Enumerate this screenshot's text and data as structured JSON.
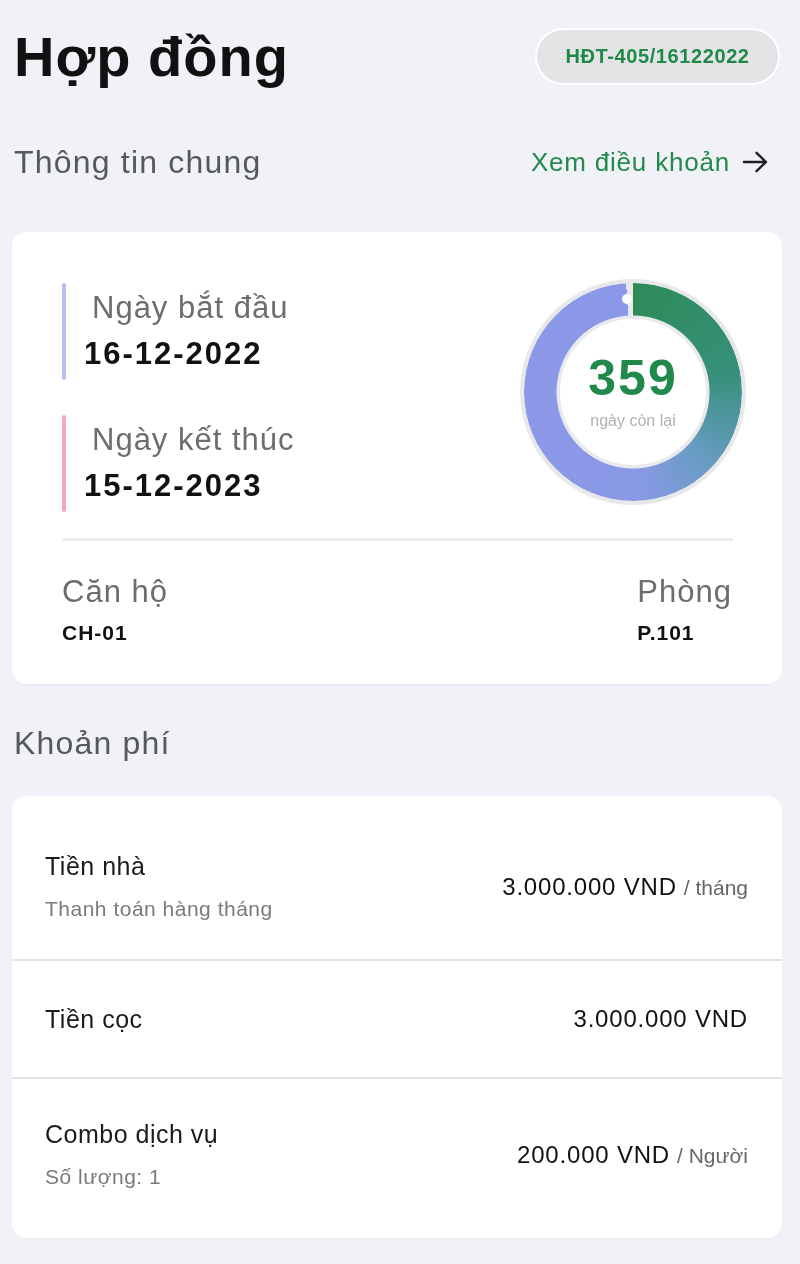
{
  "header": {
    "title": "Hợp đồng",
    "contract_code": "HĐT-405/16122022"
  },
  "general_info": {
    "heading": "Thông tin chung",
    "link": "Xem điều khoản",
    "dates": [
      {
        "label": "Ngày bắt đầu",
        "value": "16-12-2022",
        "color": "#b8c2ef"
      },
      {
        "label": "Ngày kết thúc",
        "value": "15-12-2023",
        "color": "#f2a8c1"
      }
    ],
    "remaining": {
      "value": "359",
      "caption": "ngày còn lại",
      "level": 0.99
    },
    "details": [
      {
        "label": "Căn hộ",
        "value": "CH-01"
      },
      {
        "label": "Phòng",
        "value": "P.101"
      }
    ]
  },
  "fees": {
    "heading": "Khoản phí",
    "items": [
      {
        "name": "Tiền nhà",
        "note": "Thanh toán hàng tháng",
        "amount": "3.000.000 VND",
        "unit": "/ tháng"
      },
      {
        "name": "Tiền cọc",
        "amount": "3.000.000 VND"
      },
      {
        "name": "Combo dịch vụ",
        "note": "Số lượng: 1",
        "amount": "200.000 VND",
        "unit": "/ Người"
      }
    ]
  }
}
